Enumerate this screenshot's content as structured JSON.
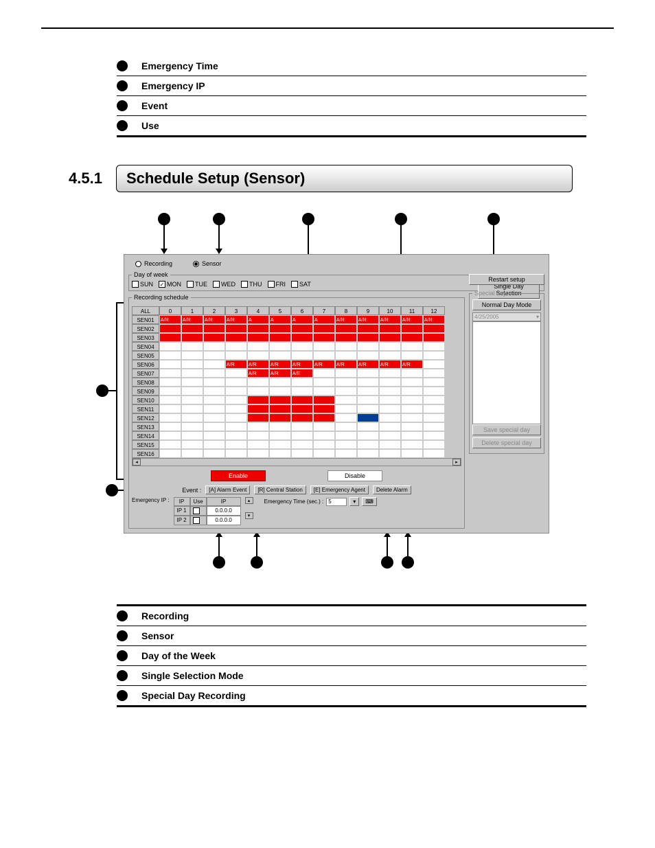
{
  "top_bullets": [
    "Emergency Time",
    "Emergency IP",
    "Event",
    "Use"
  ],
  "section": {
    "number": "4.5.1",
    "title": "Schedule Setup (Sensor)"
  },
  "dialog": {
    "radio_recording": "Recording",
    "radio_sensor": "Sensor",
    "group_dayofweek": "Day of week",
    "days": [
      "SUN",
      "MON",
      "TUE",
      "WED",
      "THU",
      "FRI",
      "SAT"
    ],
    "days_checked": [
      false,
      true,
      false,
      false,
      false,
      false,
      false
    ],
    "single_day_btn": "Single Day Selection",
    "restart_btn": "Restart setup",
    "group_schedule": "Recording schedule",
    "group_special": "Special day",
    "normal_day_btn": "Normal Day Mode",
    "special_date": "4/25/2005",
    "save_special_btn": "Save special day",
    "delete_special_btn": "Delete special day",
    "row_labels": [
      "ALL",
      "SEN01",
      "SEN02",
      "SEN03",
      "SEN04",
      "SEN05",
      "SEN06",
      "SEN07",
      "SEN08",
      "SEN09",
      "SEN10",
      "SEN11",
      "SEN12",
      "SEN13",
      "SEN14",
      "SEN15",
      "SEN16"
    ],
    "col_headers": [
      "0",
      "1",
      "2",
      "3",
      "4",
      "5",
      "6",
      "7",
      "8",
      "9",
      "10",
      "11",
      "12"
    ],
    "enable_label": "Enable",
    "disable_label": "Disable",
    "event_label": "Event :",
    "event_buttons": [
      "[A] Alarm Event",
      "[R] Central Station",
      "[E] Emergency Agent",
      "Delete Alarm"
    ],
    "emergency_ip_label": "Emergency IP :",
    "ip_header": [
      "IP",
      "Use",
      "IP"
    ],
    "ip_rows": [
      [
        "IP 1",
        "",
        "0.0.0.0"
      ],
      [
        "IP 2",
        "",
        "0.0.0.0"
      ]
    ],
    "emergency_time_label": "Emergency Time (sec.) :",
    "emergency_time_value": "5",
    "cell_text_ar": "A/R",
    "cell_text_a": "A",
    "cell_text_ae": "A/E"
  },
  "bottom_bullets": [
    "Recording",
    "Sensor",
    "Day of the Week",
    "Single Selection Mode",
    "Special Day Recording"
  ]
}
